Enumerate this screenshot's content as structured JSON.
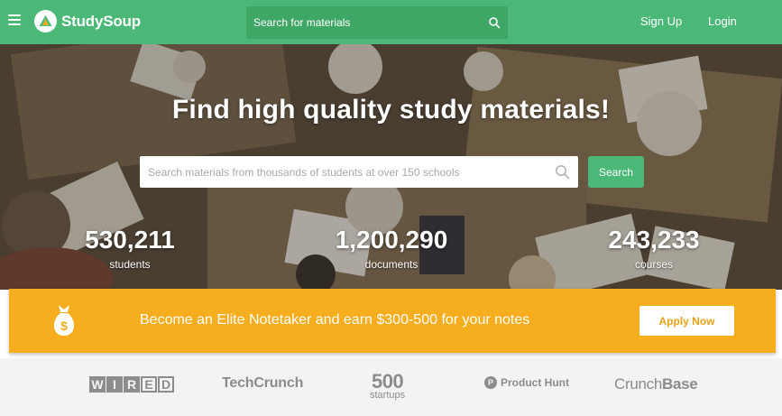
{
  "header": {
    "logo_text": "StudySoup",
    "search_placeholder": "Search for materials",
    "signup_label": "Sign Up",
    "login_label": "Login",
    "brand_color": "#4cb877"
  },
  "hero": {
    "title": "Find high quality study materials!",
    "search_placeholder": "Search materials from thousands of students at over 150 schools",
    "search_button": "Search",
    "stats": [
      {
        "number": "530,211",
        "label": "students"
      },
      {
        "number": "1,200,290",
        "label": "documents"
      },
      {
        "number": "243,233",
        "label": "courses"
      }
    ]
  },
  "promo": {
    "text": "Become an Elite Notetaker and earn $300-500 for your notes",
    "button": "Apply Now",
    "icon": "money-bag-icon",
    "color": "#f6ad1e"
  },
  "press": {
    "wired": [
      "W",
      "I",
      "R",
      "E",
      "D"
    ],
    "techcrunch": "TechCrunch",
    "startups_num": "500",
    "startups_word": "startups",
    "producthunt_letter": "P",
    "producthunt": "Product Hunt",
    "crunchbase_a": "Crunch",
    "crunchbase_b": "Base"
  }
}
